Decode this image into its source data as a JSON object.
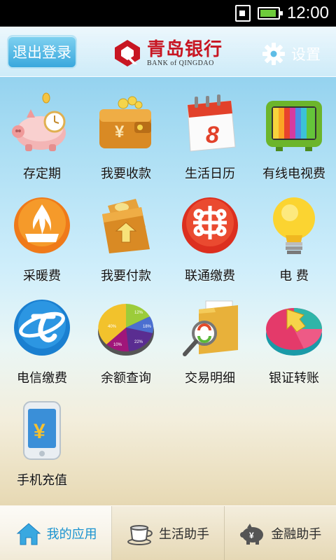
{
  "status_bar": {
    "time": "12:00"
  },
  "header": {
    "logout_label": "退出登录",
    "brand_cn": "青岛银行",
    "brand_en": "BANK of QINGDAO",
    "settings_label": "设置"
  },
  "apps": [
    {
      "label": "存定期",
      "icon": "piggy-bank-icon"
    },
    {
      "label": "我要收款",
      "icon": "wallet-yuan-icon"
    },
    {
      "label": "生活日历",
      "icon": "calendar-icon"
    },
    {
      "label": "有线电视费",
      "icon": "tv-icon"
    },
    {
      "label": "采暖费",
      "icon": "flame-icon"
    },
    {
      "label": "我要付款",
      "icon": "wallet-pay-icon"
    },
    {
      "label": "联通缴费",
      "icon": "unicom-icon"
    },
    {
      "label": "电 费",
      "icon": "lightbulb-icon"
    },
    {
      "label": "电信缴费",
      "icon": "telecom-icon"
    },
    {
      "label": "余额查询",
      "icon": "pie-chart-icon"
    },
    {
      "label": "交易明细",
      "icon": "folder-magnifier-icon"
    },
    {
      "label": "银证转账",
      "icon": "transfer-icon"
    },
    {
      "label": "手机充值",
      "icon": "phone-recharge-icon"
    }
  ],
  "pie_labels": [
    "12%",
    "18%",
    "22%",
    "10%",
    "40%"
  ],
  "calendar_day": "8",
  "tabs": [
    {
      "label": "我的应用",
      "icon": "home-icon"
    },
    {
      "label": "生活助手",
      "icon": "coffee-cup-icon"
    },
    {
      "label": "金融助手",
      "icon": "piggy-icon"
    }
  ],
  "colors": {
    "brand_red": "#c81622",
    "accent_blue": "#1a93d0"
  }
}
